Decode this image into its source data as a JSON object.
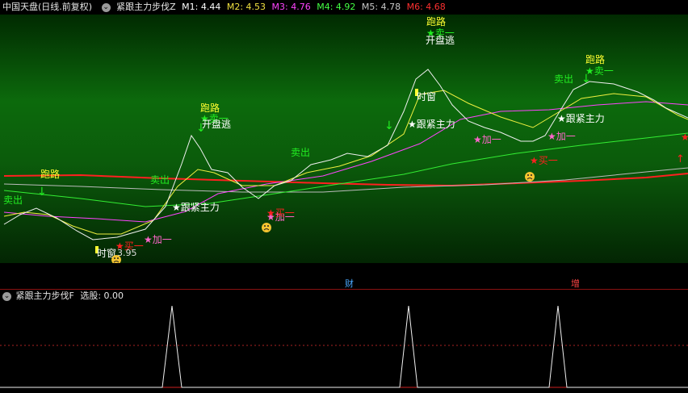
{
  "header": {
    "symbol": "中国天盘(日线.前复权)",
    "indicator": "紧跟主力步伐Z",
    "ma": [
      {
        "label": "M1: 4.44",
        "color": "#ffffff"
      },
      {
        "label": "M2: 4.53",
        "color": "#f0e040"
      },
      {
        "label": "M3: 4.76",
        "color": "#ff44ff"
      },
      {
        "label": "M4: 4.92",
        "color": "#44ff44"
      },
      {
        "label": "M5: 4.78",
        "color": "#c8c8c8"
      },
      {
        "label": "M6: 4.68",
        "color": "#ff3030"
      }
    ]
  },
  "main_labels": {
    "run": "跑路",
    "sell": "卖出",
    "sell_one": "卖一",
    "buy_one": "买一",
    "add_one": "加一",
    "follow": "跟紧主力",
    "open_escape": "开盘逃",
    "timing": "时窗",
    "low_price": "3.95"
  },
  "separator": {
    "cai": "财",
    "zeng": "增"
  },
  "indicator_panel": {
    "title": "紧跟主力步伐F",
    "pick": "选股: 0.00"
  },
  "colors": {
    "bg_top": "#012a01",
    "bg_mid": "#0c6a0c",
    "red": "#ff2020",
    "yellow": "#ffff30",
    "green": "#22dd22",
    "magenta": "#ff66cc"
  }
}
